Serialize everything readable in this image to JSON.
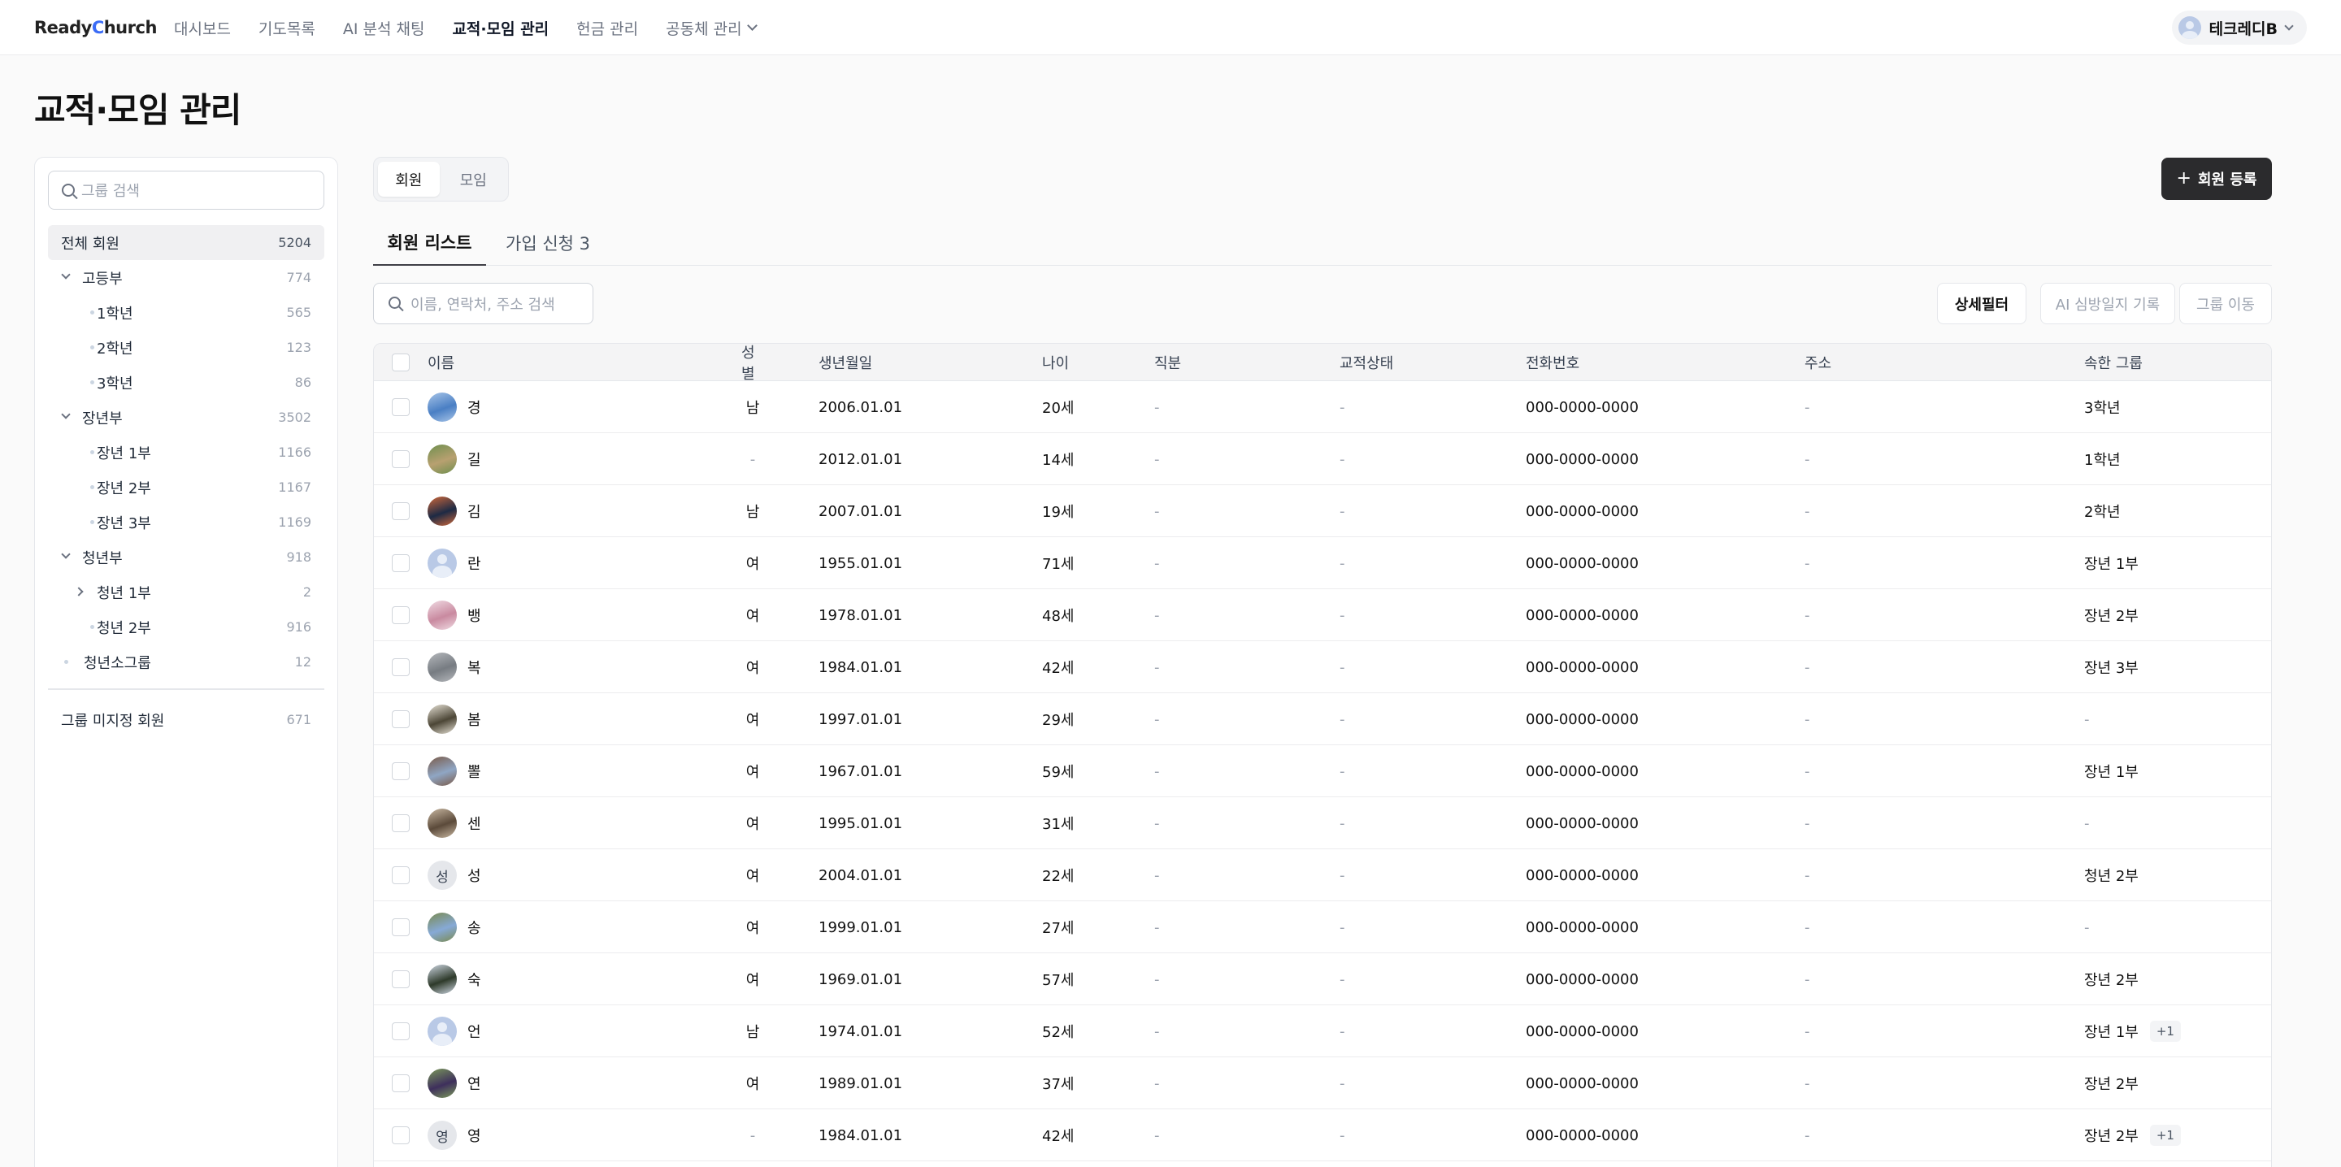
{
  "app": {
    "logo_prefix": "Ready ",
    "logo_c": "C",
    "logo_suffix": "hurch",
    "nav": [
      "대시보드",
      "기도목록",
      "AI 분석 채팅",
      "교적·모임 관리",
      "헌금 관리",
      "공동체 관리"
    ],
    "user_name": "테크레디B"
  },
  "page": {
    "title": "교적·모임 관리"
  },
  "sidebar": {
    "search_placeholder": "그룹 검색",
    "all": {
      "label": "전체 회원",
      "count": "5204"
    },
    "groups": [
      {
        "label": "고등부",
        "count": "774",
        "level": 0,
        "toggle": "down"
      },
      {
        "label": "1학년",
        "count": "565",
        "level": 1,
        "toggle": "dot"
      },
      {
        "label": "2학년",
        "count": "123",
        "level": 1,
        "toggle": "dot"
      },
      {
        "label": "3학년",
        "count": "86",
        "level": 1,
        "toggle": "dot"
      },
      {
        "label": "장년부",
        "count": "3502",
        "level": 0,
        "toggle": "down"
      },
      {
        "label": "장년 1부",
        "count": "1166",
        "level": 1,
        "toggle": "dot"
      },
      {
        "label": "장년 2부",
        "count": "1167",
        "level": 1,
        "toggle": "dot"
      },
      {
        "label": "장년 3부",
        "count": "1169",
        "level": 1,
        "toggle": "dot"
      },
      {
        "label": "청년부",
        "count": "918",
        "level": 0,
        "toggle": "down"
      },
      {
        "label": "청년 1부",
        "count": "2",
        "level": 1,
        "toggle": "right"
      },
      {
        "label": "청년 2부",
        "count": "916",
        "level": 1,
        "toggle": "dot"
      },
      {
        "label": "청년소그룹",
        "count": "12",
        "level": 0,
        "toggle": "dot"
      }
    ],
    "unassigned": {
      "label": "그룹 미지정 회원",
      "count": "671"
    }
  },
  "main": {
    "segment": [
      "회원",
      "모임"
    ],
    "register_label": "회원 등록",
    "tabs": [
      "회원 리스트",
      "가입 신청 3"
    ],
    "search_placeholder": "이름, 연락처, 주소 검색",
    "buttons": [
      "상세필터",
      "AI 심방일지 기록",
      "그룹 이동"
    ]
  },
  "table": {
    "headers": [
      "이름",
      "성별",
      "생년월일",
      "나이",
      "직분",
      "교적상태",
      "전화번호",
      "주소",
      "속한 그룹"
    ],
    "rows": [
      {
        "name": "경",
        "gender": "남",
        "birth": "2006.01.01",
        "age": "20세",
        "position": "-",
        "status": "-",
        "phone": "000-0000-0000",
        "address": "-",
        "group": "3학년",
        "extra": "",
        "avatar": "photo",
        "avatar_colors": [
          "#4a7fc4",
          "#a8c5e8"
        ]
      },
      {
        "name": "길",
        "gender": "-",
        "birth": "2012.01.01",
        "age": "14세",
        "position": "-",
        "status": "-",
        "phone": "000-0000-0000",
        "address": "-",
        "group": "1학년",
        "extra": "",
        "avatar": "photo",
        "avatar_colors": [
          "#b8a070",
          "#6e8f4e"
        ]
      },
      {
        "name": "김",
        "gender": "남",
        "birth": "2007.01.01",
        "age": "19세",
        "position": "-",
        "status": "-",
        "phone": "000-0000-0000",
        "address": "-",
        "group": "2학년",
        "extra": "",
        "avatar": "photo",
        "avatar_colors": [
          "#1d2a44",
          "#d0683a"
        ]
      },
      {
        "name": "란",
        "gender": "여",
        "birth": "1955.01.01",
        "age": "71세",
        "position": "-",
        "status": "-",
        "phone": "000-0000-0000",
        "address": "-",
        "group": "장년 1부",
        "extra": "",
        "avatar": "person",
        "avatar_colors": []
      },
      {
        "name": "뱅",
        "gender": "여",
        "birth": "1978.01.01",
        "age": "48세",
        "position": "-",
        "status": "-",
        "phone": "000-0000-0000",
        "address": "-",
        "group": "장년 2부",
        "extra": "",
        "avatar": "photo",
        "avatar_colors": [
          "#c98aa0",
          "#f0dbe3"
        ]
      },
      {
        "name": "복",
        "gender": "여",
        "birth": "1984.01.01",
        "age": "42세",
        "position": "-",
        "status": "-",
        "phone": "000-0000-0000",
        "address": "-",
        "group": "장년 3부",
        "extra": "",
        "avatar": "photo",
        "avatar_colors": [
          "#777c82",
          "#b5b8bc"
        ]
      },
      {
        "name": "봄",
        "gender": "여",
        "birth": "1997.01.01",
        "age": "29세",
        "position": "-",
        "status": "-",
        "phone": "000-0000-0000",
        "address": "-",
        "group": "-",
        "extra": "",
        "avatar": "photo",
        "avatar_colors": [
          "#4c4636",
          "#e7e2d6"
        ]
      },
      {
        "name": "뽈",
        "gender": "여",
        "birth": "1967.01.01",
        "age": "59세",
        "position": "-",
        "status": "-",
        "phone": "000-0000-0000",
        "address": "-",
        "group": "장년 1부",
        "extra": "",
        "avatar": "photo",
        "avatar_colors": [
          "#8fa6c4",
          "#7a5a48"
        ]
      },
      {
        "name": "센",
        "gender": "여",
        "birth": "1995.01.01",
        "age": "31세",
        "position": "-",
        "status": "-",
        "phone": "000-0000-0000",
        "address": "-",
        "group": "-",
        "extra": "",
        "avatar": "photo",
        "avatar_colors": [
          "#5b4a3a",
          "#c9b8a2"
        ]
      },
      {
        "name": "성",
        "gender": "여",
        "birth": "2004.01.01",
        "age": "22세",
        "position": "-",
        "status": "-",
        "phone": "000-0000-0000",
        "address": "-",
        "group": "청년 2부",
        "extra": "",
        "avatar": "letter",
        "avatar_colors": []
      },
      {
        "name": "송",
        "gender": "여",
        "birth": "1999.01.01",
        "age": "27세",
        "position": "-",
        "status": "-",
        "phone": "000-0000-0000",
        "address": "-",
        "group": "-",
        "extra": "",
        "avatar": "photo",
        "avatar_colors": [
          "#86a9d6",
          "#7a8a50"
        ]
      },
      {
        "name": "숙",
        "gender": "여",
        "birth": "1969.01.01",
        "age": "57세",
        "position": "-",
        "status": "-",
        "phone": "000-0000-0000",
        "address": "-",
        "group": "장년 2부",
        "extra": "",
        "avatar": "photo",
        "avatar_colors": [
          "#2e3a2a",
          "#cfd8e4"
        ]
      },
      {
        "name": "언",
        "gender": "남",
        "birth": "1974.01.01",
        "age": "52세",
        "position": "-",
        "status": "-",
        "phone": "000-0000-0000",
        "address": "-",
        "group": "장년 1부",
        "extra": "+1",
        "avatar": "person",
        "avatar_colors": []
      },
      {
        "name": "연",
        "gender": "여",
        "birth": "1989.01.01",
        "age": "37세",
        "position": "-",
        "status": "-",
        "phone": "000-0000-0000",
        "address": "-",
        "group": "장년 2부",
        "extra": "",
        "avatar": "photo",
        "avatar_colors": [
          "#3e2f5c",
          "#7b9a5a"
        ]
      },
      {
        "name": "영",
        "gender": "-",
        "birth": "1984.01.01",
        "age": "42세",
        "position": "-",
        "status": "-",
        "phone": "000-0000-0000",
        "address": "-",
        "group": "장년 2부",
        "extra": "+1",
        "avatar": "letter",
        "avatar_colors": []
      }
    ]
  }
}
